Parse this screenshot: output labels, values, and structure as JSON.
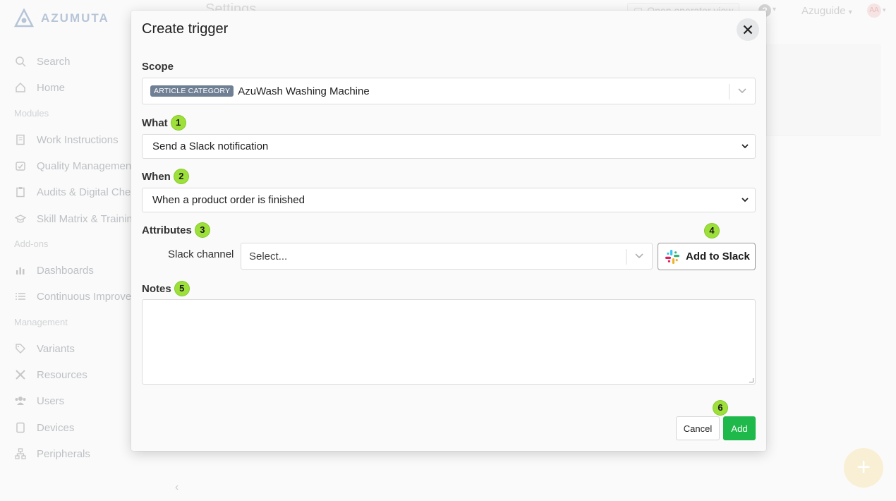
{
  "app": {
    "brand": "AZUMUTA",
    "page_title": "Settings",
    "operator_view": "Open operator view",
    "user": "Azuguide",
    "avatar_initials": "AA"
  },
  "sidebar": {
    "items": [
      {
        "label": "Search",
        "icon": "search-icon"
      },
      {
        "label": "Home",
        "icon": "home-icon"
      },
      {
        "label": "Modules",
        "section": true
      },
      {
        "label": "Work Instructions",
        "icon": "document-icon"
      },
      {
        "label": "Quality Management",
        "icon": "quality-icon"
      },
      {
        "label": "Audits & Digital Checks",
        "icon": "clipboard-icon"
      },
      {
        "label": "Skill Matrix & Training",
        "icon": "graduation-icon"
      },
      {
        "label": "Add-ons",
        "section": true
      },
      {
        "label": "Dashboards",
        "icon": "bar-chart-icon"
      },
      {
        "label": "Continuous Improvement",
        "icon": "list-icon"
      },
      {
        "label": "Management",
        "section": true
      },
      {
        "label": "Variants",
        "icon": "tag-icon"
      },
      {
        "label": "Resources",
        "icon": "tools-icon"
      },
      {
        "label": "Users",
        "icon": "users-icon"
      },
      {
        "label": "Devices",
        "icon": "tablet-icon"
      },
      {
        "label": "Peripherals",
        "icon": "network-icon"
      }
    ]
  },
  "modal": {
    "title": "Create trigger",
    "scope": {
      "label": "Scope",
      "tag": "ARTICLE CATEGORY",
      "value": "AzuWash Washing Machine"
    },
    "what": {
      "label": "What",
      "step": "1",
      "value": "Send a Slack notification"
    },
    "when": {
      "label": "When",
      "step": "2",
      "value": "When a product order is finished"
    },
    "attributes": {
      "label": "Attributes",
      "step": "3",
      "slack_channel_label": "Slack channel",
      "slack_channel_placeholder": "Select...",
      "add_to_slack_step": "4",
      "add_to_slack_prefix": "Add to ",
      "add_to_slack_brand": "Slack"
    },
    "notes": {
      "label": "Notes",
      "step": "5",
      "value": ""
    },
    "actions": {
      "step": "6",
      "cancel": "Cancel",
      "add": "Add"
    }
  },
  "colors": {
    "step_badge": "#9ee03a",
    "add_button": "#1fb84a",
    "scope_tag": "#6f7f94"
  }
}
